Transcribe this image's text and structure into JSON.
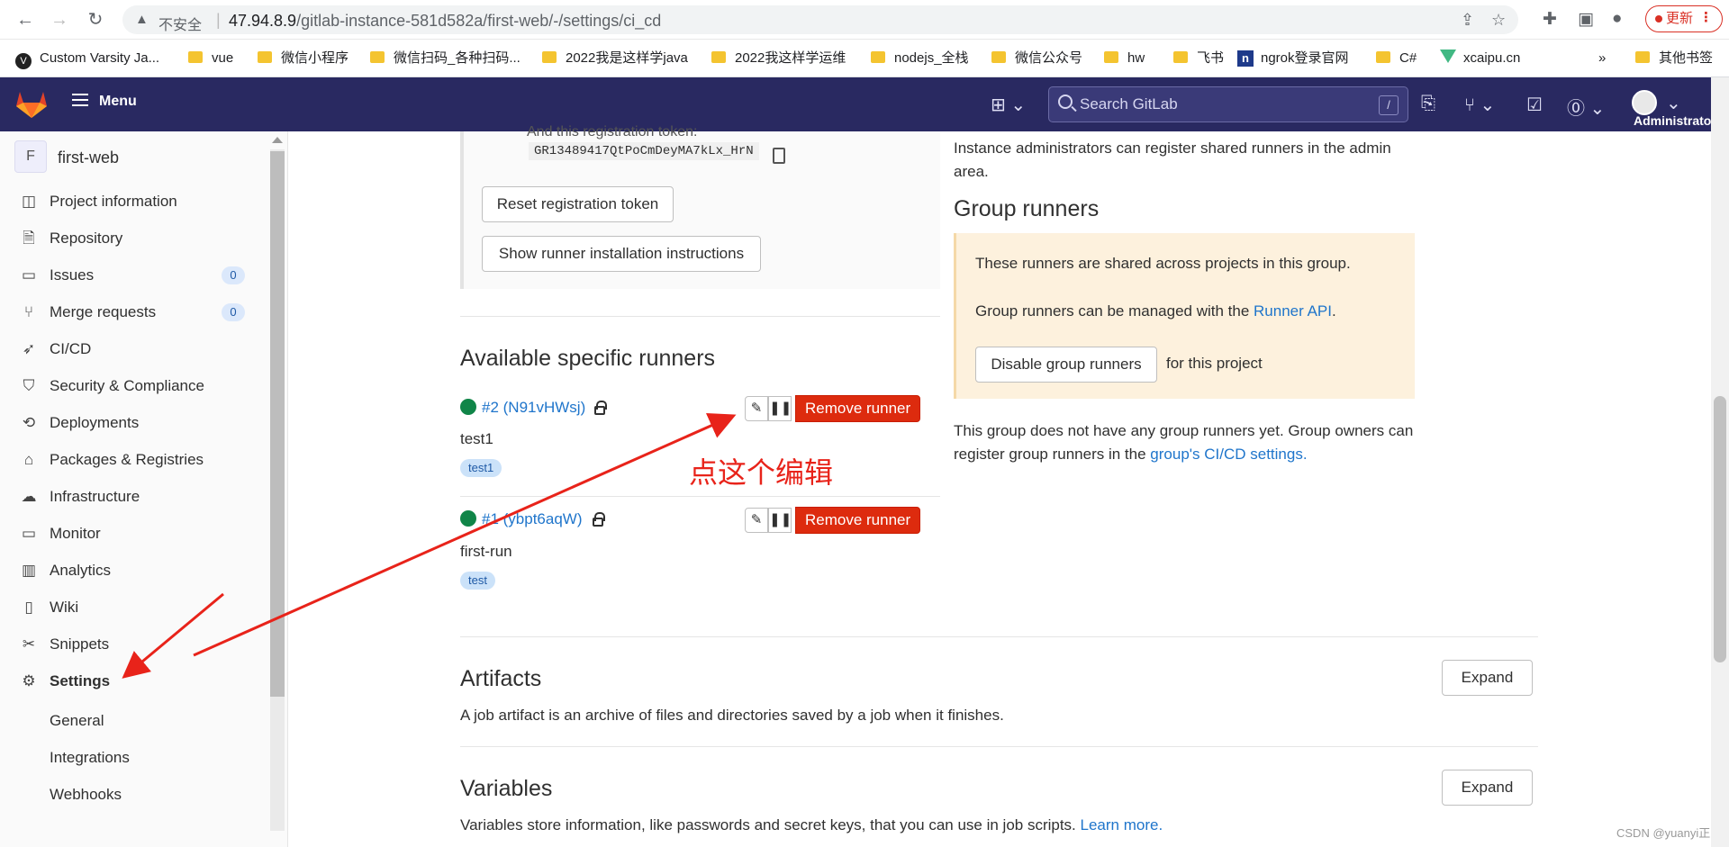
{
  "browser": {
    "insecure_label": "不安全",
    "url_host": "47.94.8.9",
    "url_path": "/gitlab-instance-581d582a/first-web/-/settings/ci_cd",
    "update_label": "更新"
  },
  "bookmarks": {
    "items": [
      "Custom Varsity Ja...",
      "vue",
      "微信小程序",
      "微信扫码_各种扫码...",
      "2022我是这样学java",
      "2022我这样学运维",
      "nodejs_全栈",
      "微信公众号",
      "hw",
      "飞书",
      "ngrok登录官网",
      "C#",
      "xcaipu.cn"
    ],
    "more": "»",
    "other": "其他书签"
  },
  "header": {
    "menu_label": "Menu",
    "search_placeholder": "Search GitLab",
    "search_shortcut": "/",
    "user_label": "Administrator"
  },
  "sidebar": {
    "project_initial": "F",
    "project_name": "first-web",
    "items": [
      {
        "label": "Project information",
        "icon": "info-icon"
      },
      {
        "label": "Repository",
        "icon": "doc-icon"
      },
      {
        "label": "Issues",
        "icon": "issues-icon",
        "count": "0"
      },
      {
        "label": "Merge requests",
        "icon": "merge-icon",
        "count": "0"
      },
      {
        "label": "CI/CD",
        "icon": "rocket-icon"
      },
      {
        "label": "Security & Compliance",
        "icon": "shield-icon"
      },
      {
        "label": "Deployments",
        "icon": "deploy-icon"
      },
      {
        "label": "Packages & Registries",
        "icon": "package-icon"
      },
      {
        "label": "Infrastructure",
        "icon": "cloud-icon"
      },
      {
        "label": "Monitor",
        "icon": "monitor-icon"
      },
      {
        "label": "Analytics",
        "icon": "chart-icon"
      },
      {
        "label": "Wiki",
        "icon": "book-icon"
      },
      {
        "label": "Snippets",
        "icon": "scissors-icon"
      },
      {
        "label": "Settings",
        "icon": "gear-icon"
      }
    ],
    "sub_items": [
      "General",
      "Integrations",
      "Webhooks"
    ]
  },
  "main": {
    "reg_token_cut": "And this registration token:",
    "reg_token": "GR13489417QtPoCmDeyMA7kLx_HrN",
    "reset_token_label": "Reset registration token",
    "show_instructions_label": "Show runner installation instructions",
    "specific_title": "Available specific runners",
    "runners": [
      {
        "id": "#2 (N91vHWsj)",
        "name": "test1",
        "tag": "test1"
      },
      {
        "id": "#1 (ybpt6aqW)",
        "name": "first-run",
        "tag": "test"
      }
    ],
    "remove_label": "Remove runner",
    "shared_text": "Instance administrators can register shared runners in the admin area.",
    "group_title": "Group runners",
    "group_box_line1": "These runners are shared across projects in this group.",
    "group_box_line2_pre": "Group runners can be managed with the ",
    "group_box_line2_link": "Runner API",
    "group_box_line2_post": ".",
    "disable_group_label": "Disable group runners",
    "disable_group_suffix": "for this project",
    "no_group_text": "This group does not have any group runners yet. Group owners can register group runners in the ",
    "no_group_link": "group's CI/CD settings.",
    "artifacts_title": "Artifacts",
    "artifacts_desc": "A job artifact is an archive of files and directories saved by a job when it finishes.",
    "variables_title": "Variables",
    "variables_desc": "Variables store information, like passwords and secret keys, that you can use in job scripts. ",
    "variables_link": "Learn more.",
    "expand_label": "Expand"
  },
  "annotation": "点这个编辑",
  "watermark": "CSDN @yuanyi正",
  "colors": {
    "header": "#292961",
    "danger": "#dd2b0e",
    "link": "#1f75cb",
    "annotation": "#e8231a"
  }
}
